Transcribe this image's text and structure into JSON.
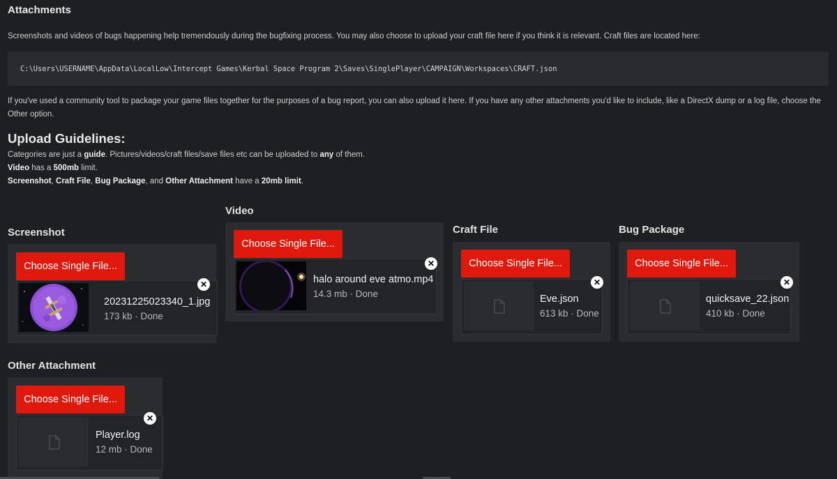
{
  "attachments": {
    "title": "Attachments",
    "intro": "Screenshots and videos of bugs happening help tremendously during the bugfixing process. You may also choose to upload your craft file here if you think it is relevant. Craft files are located here:",
    "path": "C:\\Users\\USERNAME\\AppData\\LocalLow\\Intercept Games\\Kerbal Space Program 2\\Saves\\SinglePlayer\\CAMPAIGN\\Workspaces\\CRAFT.json",
    "community": "If you've used a community tool to package your game files together for the purposes of a bug report, you can also upload it here. If you have any other attachments you'd like to include, like a DirectX dump or a log file, choose the Other option."
  },
  "guidelines": {
    "title": "Upload Guidelines:",
    "l1_a": "Categories are just a ",
    "l1_b": "guide",
    "l1_c": ". Pictures/videos/craft files/save files etc can be uploaded to ",
    "l1_d": "any",
    "l1_e": " of them.",
    "l2_a": "Video",
    "l2_b": " has a ",
    "l2_c": "500mb",
    "l2_d": " limit.",
    "l3_a": "Screenshot",
    "l3_b": ", ",
    "l3_c": "Craft File",
    "l3_d": ", ",
    "l3_e": "Bug Package",
    "l3_f": ", and ",
    "l3_g": "Other Attachment",
    "l3_h": " have a ",
    "l3_i": "20mb limit",
    "l3_j": "."
  },
  "choose_label": "Choose Single File...",
  "close_symbol": "✕",
  "sections": {
    "screenshot": {
      "title": "Screenshot",
      "file_name": "20231225023340_1.jpg",
      "file_meta": "173 kb · Done",
      "thumb_icon": "image-thumbnail"
    },
    "video": {
      "title": "Video",
      "file_name": "halo around eve atmo.mp4",
      "file_meta": "14.3 mb · Done",
      "thumb_icon": "video-thumbnail"
    },
    "craft": {
      "title": "Craft File",
      "file_name": "Eve.json",
      "file_meta": "613 kb · Done",
      "thumb_icon": "file-icon"
    },
    "bug": {
      "title": "Bug Package",
      "file_name": "quicksave_22.json",
      "file_meta": "410 kb · Done",
      "thumb_icon": "file-icon"
    },
    "other": {
      "title": "Other Attachment",
      "file_name": "Player.log",
      "file_meta": "12 mb · Done",
      "thumb_icon": "file-icon"
    }
  },
  "colors": {
    "background": "#1d1f21",
    "panel": "#2b2c2f",
    "button": "#e0190f",
    "text": "#d2d2d2"
  }
}
